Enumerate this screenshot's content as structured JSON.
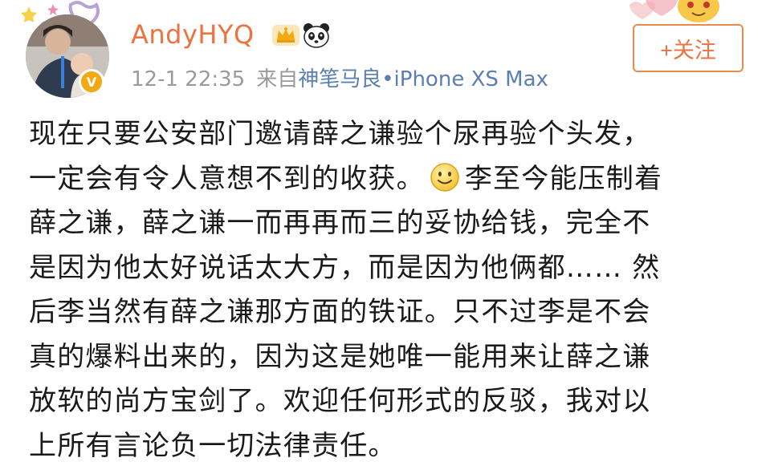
{
  "post": {
    "author": {
      "name": "AndyHYQ",
      "badges": [
        "crown-icon",
        "panda-icon"
      ],
      "verified": true
    },
    "timestamp": "12-1 22:35",
    "source_prefix": "来自",
    "source_device": "神笔马良•iPhone XS Max",
    "follow_button": "+关注",
    "body_lines": [
      {
        "before": "现在只要公安部门邀请薛之谦验个尿再验个头发，",
        "after": ""
      },
      {
        "before": "一定会有令人意想不到的收获。",
        "emoji": "smile-icon",
        "after": "李至今能压制着"
      },
      {
        "before": "薛之谦，薛之谦一而再再而三的妥协给钱，完全不",
        "after": ""
      },
      {
        "before": "是因为他太好说话太大方，而是因为他俩都…… 然",
        "after": ""
      },
      {
        "before": "后李当然有薛之谦那方面的铁证。只不过李是不会",
        "after": ""
      },
      {
        "before": "真的爆料出来的，因为这是她唯一能用来让薛之谦",
        "after": ""
      },
      {
        "before": "放软的尚方宝剑了。欢迎任何形式的反驳，我对以",
        "after": ""
      },
      {
        "before": "上所有言论负一切法律责任。",
        "after": ""
      }
    ]
  },
  "colors": {
    "username": "#eb7340",
    "link": "#5a7fb0",
    "meta": "#9a9a9a",
    "text": "#1a1a1a"
  }
}
